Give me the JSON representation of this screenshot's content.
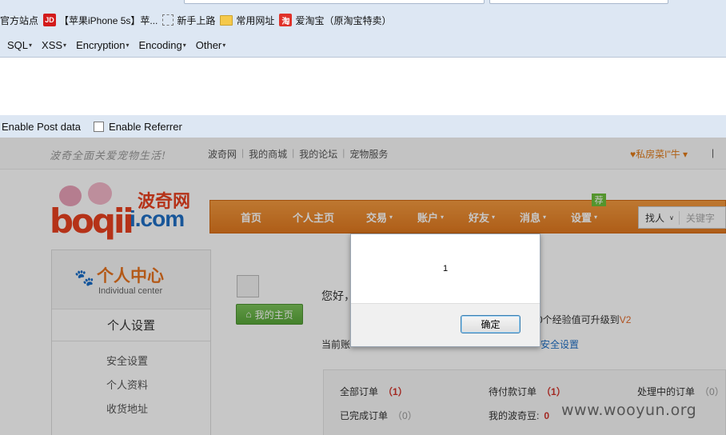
{
  "bookmarks": [
    {
      "label": "官方站点",
      "icon": "none"
    },
    {
      "label": "【苹果iPhone 5s】苹...",
      "icon": "jd-icon",
      "icon_text": "JD"
    },
    {
      "label": "新手上路",
      "icon": "dashed-page-icon"
    },
    {
      "label": "常用网址",
      "icon": "folder-icon"
    },
    {
      "label": "爱淘宝（原淘宝特卖）",
      "icon": "taobao-icon",
      "icon_text": "淘"
    }
  ],
  "hackbar": {
    "menus": [
      "SQL",
      "XSS",
      "Encryption",
      "Encoding",
      "Other"
    ],
    "enable_post": "Enable Post data",
    "enable_referrer": "Enable Referrer"
  },
  "site": {
    "slogan": "波奇全面关爱宠物生活!",
    "top_links": [
      "波奇网",
      "我的商城",
      "我的论坛",
      "宠物服务"
    ],
    "user_link": "♥私房菜I\"牛 ▾",
    "pipe": "|",
    "logo_cn": "波奇网",
    "logo_com": "i.com",
    "logo_b": "boqii",
    "nav": [
      {
        "label": "首页",
        "dropdown": false
      },
      {
        "label": "个人主页",
        "dropdown": false
      },
      {
        "label": "交易",
        "dropdown": true
      },
      {
        "label": "账户",
        "dropdown": true
      },
      {
        "label": "好友",
        "dropdown": true
      },
      {
        "label": "消息",
        "dropdown": true
      },
      {
        "label": "设置",
        "dropdown": true
      }
    ],
    "rec_badge": "荐",
    "search_select": "找人",
    "search_placeholder": "关键字"
  },
  "sidebar": {
    "title": "个人中心",
    "subtitle": "Individual center",
    "section": "个人设置",
    "links": [
      "安全设置",
      "个人资料",
      "收货地址"
    ]
  },
  "profile": {
    "home_button": "我的主页",
    "hello": "您好，",
    "exp_text": "0个经验值可升级到",
    "exp_level": "V2",
    "account_text": "当前账",
    "safe_link": "安全设置"
  },
  "orders": [
    {
      "label": "全部订单",
      "count": "（1）",
      "style": "red"
    },
    {
      "label": "待付款订单",
      "count": "（1）",
      "style": "red"
    },
    {
      "label": "处理中的订单",
      "count": "（0）",
      "style": "gray"
    },
    {
      "label": "已完成订单",
      "count": "（0）",
      "style": "gray"
    },
    {
      "label": "我的波奇豆:",
      "count": "0",
      "style": "red"
    }
  ],
  "watermark": "www.wooyun.org",
  "dialog": {
    "message": "1",
    "ok_label": "确定"
  },
  "colors": {
    "nav_orange": "#e0781f",
    "accent_blue": "#1f6fc5",
    "green_button": "#58a639",
    "chrome_blue": "#dde7f3"
  }
}
